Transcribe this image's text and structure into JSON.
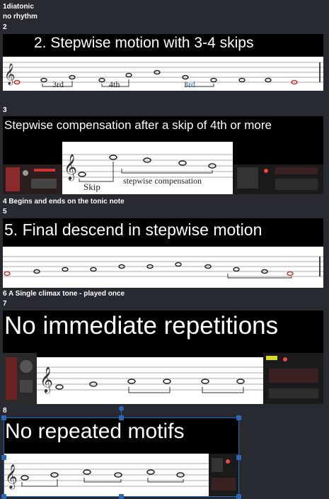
{
  "lines": {
    "l1": "1diatonic",
    "l2": "no rhythm",
    "l3": "2",
    "l4": "3",
    "l5": "4 Begins and ends on the tonic note",
    "l6": "5",
    "l7": "6 A Single climax tone - played once",
    "l8": "7",
    "l9": "8"
  },
  "images": {
    "img2": {
      "title": "2. Stepwise motion with 3-4 skips",
      "labels": [
        "3rd",
        "4th",
        "3rd"
      ]
    },
    "img3": {
      "title": "Stepwise compensation after a skip of 4th or more",
      "labels": [
        "Skip",
        "stepwise compensation"
      ]
    },
    "img5": {
      "title": "5. Final descend in stepwise motion"
    },
    "img7": {
      "title": "No immediate repetitions"
    },
    "img8": {
      "title": "No repeated motifs"
    }
  },
  "colors": {
    "background": "#272a30",
    "selection": "#2b67b8",
    "tonic_note": "#c0392b",
    "label_blue": "#2a6fb0"
  }
}
